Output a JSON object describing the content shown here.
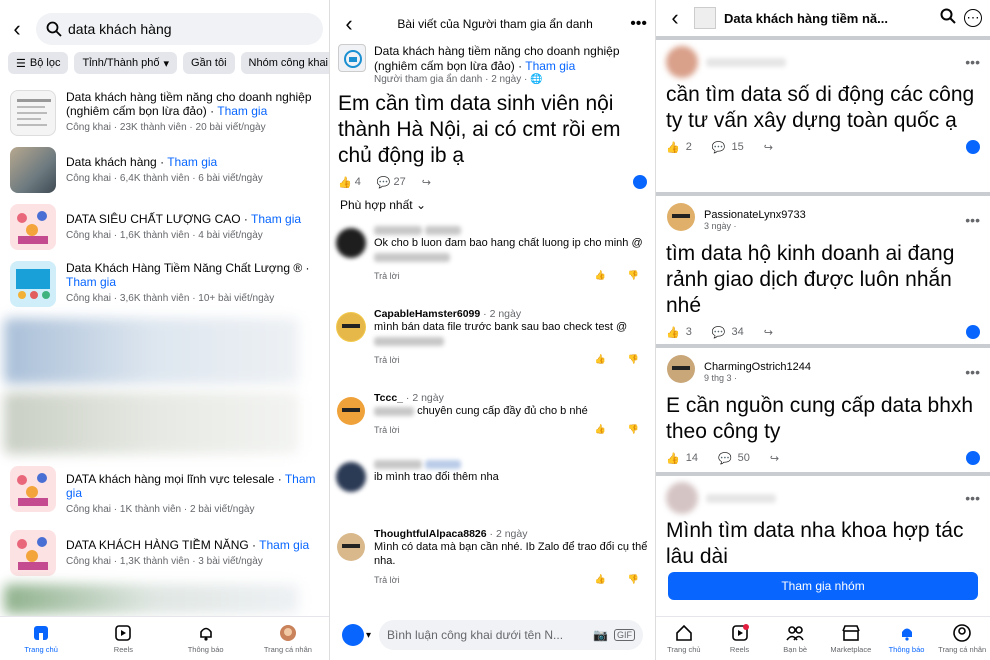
{
  "search": {
    "query": "data khách hàng"
  },
  "chips": [
    "Bộ lọc",
    "Tỉnh/Thành phố",
    "Gần tôi",
    "Nhóm công khai"
  ],
  "groups": [
    {
      "name": "Data khách hàng tiềm năng cho doanh nghiệp (nghiêm cấm bọn lừa đảo)",
      "join": "Tham gia",
      "meta": "Công khai · 23K thành viên · 20 bài viết/ngày"
    },
    {
      "name": "Data khách hàng",
      "join": "Tham gia",
      "meta": "Công khai · 6,4K thành viên · 6 bài viết/ngày"
    },
    {
      "name": "DATA SIÊU CHẤT  LƯỢNG CAO",
      "join": "Tham gia",
      "meta": "Công khai · 1,6K thành viên · 4 bài viết/ngày"
    },
    {
      "name": "Data Khách Hàng Tiềm Năng Chất Lượng ®",
      "join": "Tham gia",
      "meta": "Công khai · 3,6K thành viên · 10+ bài viết/ngày"
    },
    {
      "name": "DATA khách hàng mọi lĩnh vực telesale",
      "join": "Tham gia",
      "meta": "Công khai · 1K thành viên · 2 bài viết/ngày"
    },
    {
      "name": "DATA KHÁCH HÀNG TIỀM NĂNG",
      "join": "Tham gia",
      "meta": "Công khai · 1,3K thành viên · 3 bài viết/ngày"
    }
  ],
  "nav1": [
    "Trang chủ",
    "Reels",
    "Thông báo",
    "Trang cá nhân"
  ],
  "post": {
    "header": "Bài viết của Người tham gia ẩn danh",
    "group": "Data khách hàng tiềm năng cho doanh nghiệp (nghiêm cấm bọn lừa đảo)",
    "join": "Tham gia",
    "sub": "Người tham gia ẩn danh · 2 ngày ·",
    "text": "Em cần tìm data sinh viên nội thành Hà Nội, ai có cmt rồi em chủ động ib ạ",
    "likes": "4",
    "comments": "27",
    "sort": "Phù hợp nhất"
  },
  "comments": [
    {
      "name": "",
      "time": "",
      "text": "Ok cho b luon đam bao hang chất luong ip cho minh @",
      "reply": "Trả lời"
    },
    {
      "name": "CapableHamster6099",
      "time": "· 2 ngày",
      "text": "mình bán data file trước bank sau bao check test @",
      "reply": "Trả lời"
    },
    {
      "name": "Tccc_",
      "time": "· 2 ngày",
      "text": "chuyên cung cấp đầy đủ cho b nhé",
      "reply": "Trả lời"
    },
    {
      "name": "",
      "time": "",
      "text": "ib mình trao đổi thêm nha",
      "reply": ""
    },
    {
      "name": "ThoughtfulAlpaca8826",
      "time": "· 2 ngày",
      "text": "Mình có data mà bạn cần nhé. Ib Zalo  để trao đổi cụ thể nha.",
      "reply": "Trả lời"
    }
  ],
  "comment_input": "Bình luận công khai dưới tên N...",
  "feed": {
    "title": "Data khách hàng tiềm nă...",
    "posts": [
      {
        "name": "",
        "time": "",
        "text": "cần tìm data số di động các công ty tư vấn xây dựng toàn quốc ạ",
        "likes": "2",
        "comments": "15"
      },
      {
        "name": "PassionateLynx9733",
        "time": "3 ngày ·",
        "text": "tìm data hộ kinh doanh ai đang rảnh giao dịch được luôn nhắn nhé",
        "likes": "3",
        "comments": "34"
      },
      {
        "name": "CharmingOstrich1244",
        "time": "9 thg 3 ·",
        "text": "E cần nguồn cung cấp data bhxh theo công ty",
        "likes": "14",
        "comments": "50"
      },
      {
        "name": "",
        "time": "",
        "text": "Mình tìm data nha khoa hợp tác lâu dài",
        "likes": "",
        "comments": ""
      }
    ],
    "join_button": "Tham gia nhóm"
  },
  "nav3": [
    "Trang chủ",
    "Reels",
    "Bạn bè",
    "Marketplace",
    "Thông báo",
    "Trang cá nhân"
  ],
  "colors": {
    "accent": "#0866ff",
    "muted": "#65676b"
  }
}
